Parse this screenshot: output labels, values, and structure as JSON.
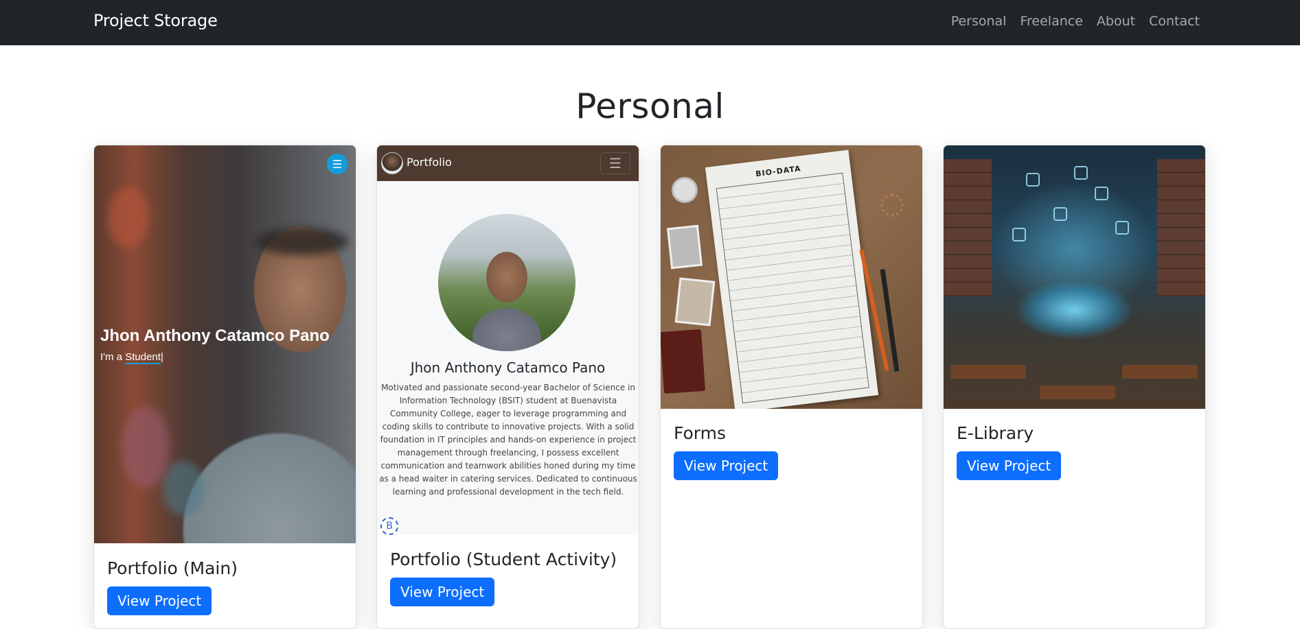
{
  "navbar": {
    "brand": "Project Storage",
    "links": [
      "Personal",
      "Freelance",
      "About",
      "Contact"
    ]
  },
  "section": {
    "title": "Personal"
  },
  "cards": [
    {
      "title": "Portfolio (Main)",
      "button": "View Project",
      "preview": {
        "menu_icon": "☰",
        "hero_name": "Jhon Anthony Catamco Pano",
        "hero_sub_prefix": "I'm a ",
        "hero_sub_typed": "Student",
        "cursor": "|"
      }
    },
    {
      "title": "Portfolio (Student Activity)",
      "button": "View Project",
      "preview": {
        "nav_brand": "Portfolio",
        "toggler_icon": "☰",
        "name": "Jhon Anthony Catamco Pano",
        "bio": "Motivated and passionate second-year Bachelor of Science in Information Technology (BSIT) student at Buenavista Community College, eager to leverage programming and coding skills to contribute to innovative projects. With a solid foundation in IT principles and hands-on experience in project management through freelancing, I possess excellent communication and teamwork abilities honed during my time as a head waiter in catering services. Dedicated to continuous learning and professional development in the tech field.",
        "badge": "B"
      }
    },
    {
      "title": "Forms",
      "button": "View Project",
      "preview": {
        "paper_title": "BIO-DATA"
      }
    },
    {
      "title": "E-Library",
      "button": "View Project",
      "preview": {}
    }
  ],
  "colors": {
    "navbar_bg": "#212529",
    "primary": "#0d6efd",
    "accent": "#149ddd"
  }
}
